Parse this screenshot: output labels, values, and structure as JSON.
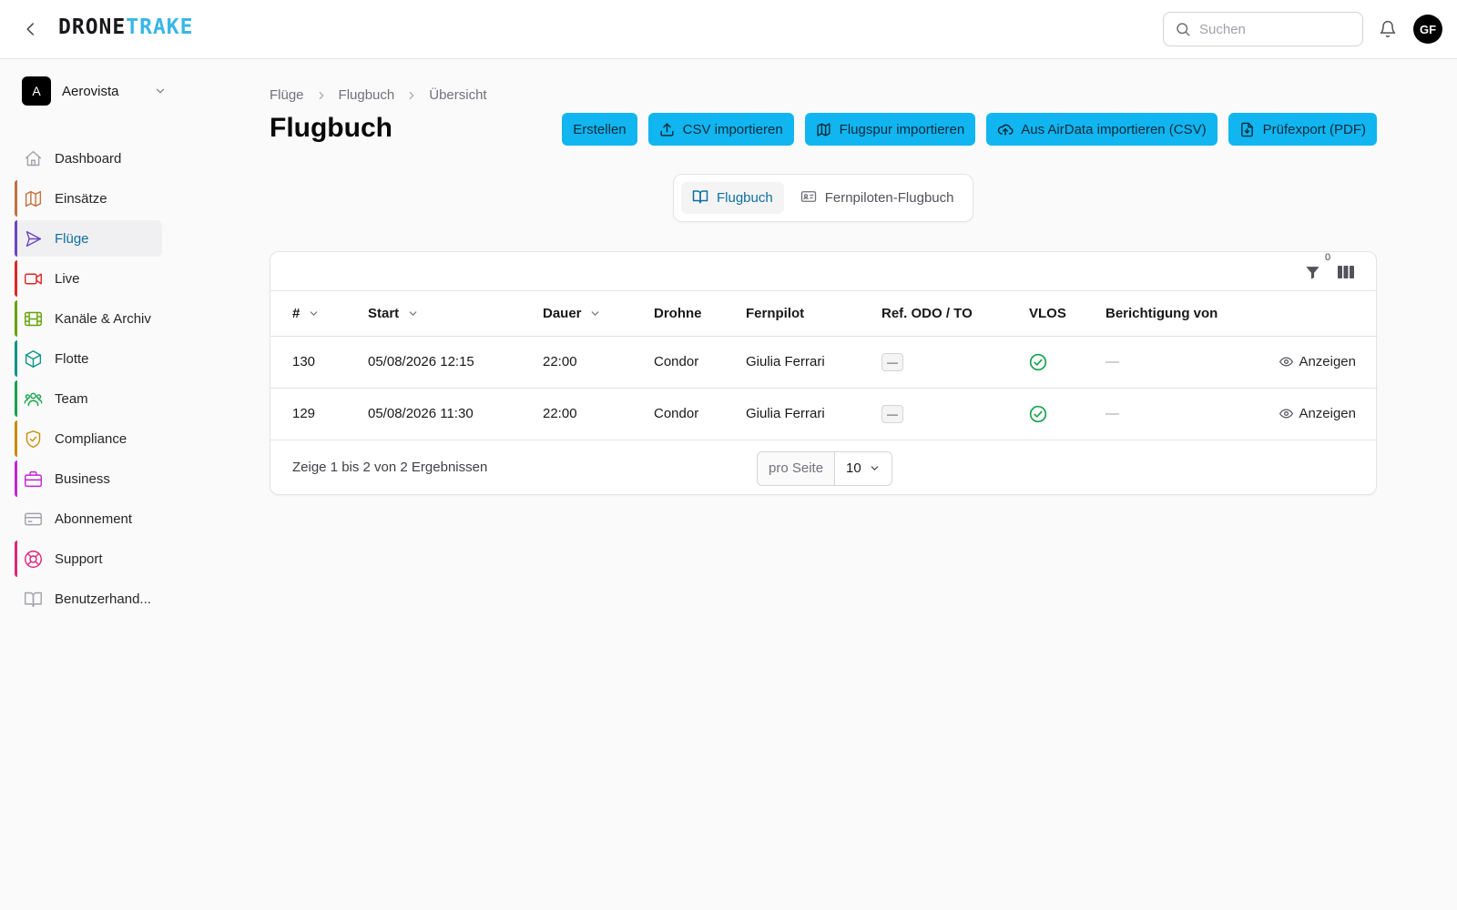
{
  "app": {
    "logo_part1": "DRONE",
    "logo_part2": "TRAKE",
    "brand_color": "#38b6e8",
    "accent_color": "#11b5f0"
  },
  "header": {
    "search_placeholder": "Suchen",
    "avatar_initials": "GF"
  },
  "org": {
    "badge": "A",
    "name": "Aerovista"
  },
  "sidebar": {
    "items": [
      {
        "label": "Dashboard",
        "icon": "home-icon",
        "color": "#a1a1aa",
        "active": false
      },
      {
        "label": "Einsätze",
        "icon": "map-icon",
        "color": "#c2703d",
        "active": false
      },
      {
        "label": "Flüge",
        "icon": "send-icon",
        "color": "#6b46c1",
        "active": true
      },
      {
        "label": "Live",
        "icon": "video-icon",
        "color": "#dc2626",
        "active": false
      },
      {
        "label": "Kanäle & Archiv",
        "icon": "film-icon",
        "color": "#65a30d",
        "active": false
      },
      {
        "label": "Flotte",
        "icon": "box-icon",
        "color": "#0d9488",
        "active": false
      },
      {
        "label": "Team",
        "icon": "users-icon",
        "color": "#16a34a",
        "active": false
      },
      {
        "label": "Compliance",
        "icon": "shield-check-icon",
        "color": "#ca8a04",
        "active": false
      },
      {
        "label": "Business",
        "icon": "briefcase-icon",
        "color": "#c026d3",
        "active": false
      },
      {
        "label": "Abonnement",
        "icon": "credit-card-icon",
        "color": "#a1a1aa",
        "active": false
      },
      {
        "label": "Support",
        "icon": "lifebuoy-icon",
        "color": "#db2777",
        "active": false
      },
      {
        "label": "Benutzerhand...",
        "icon": "book-icon",
        "color": "#a1a1aa",
        "active": false
      }
    ]
  },
  "breadcrumb": {
    "items": [
      "Flüge",
      "Flugbuch",
      "Übersicht"
    ]
  },
  "page": {
    "title": "Flugbuch"
  },
  "actions": [
    {
      "label": "Erstellen",
      "icon": ""
    },
    {
      "label": "CSV importieren",
      "icon": "upload-icon"
    },
    {
      "label": "Flugspur importieren",
      "icon": "map-icon"
    },
    {
      "label": "Aus AirData importieren (CSV)",
      "icon": "cloud-upload-icon"
    },
    {
      "label": "Prüfexport (PDF)",
      "icon": "file-download-icon"
    }
  ],
  "tabs": [
    {
      "label": "Flugbuch",
      "icon": "book-open-icon",
      "active": true
    },
    {
      "label": "Fernpiloten-Flugbuch",
      "icon": "id-card-icon",
      "active": false
    }
  ],
  "table": {
    "filter_count": "0",
    "columns": [
      "#",
      "Start",
      "Dauer",
      "Drohne",
      "Fernpilot",
      "Ref. ODO / TO",
      "VLOS",
      "Berichtigung von"
    ],
    "rows": [
      {
        "id": "130",
        "start": "05/08/2026 12:15",
        "dauer": "22:00",
        "drohne": "Condor",
        "fernpilot": "Giulia Ferrari",
        "ref": "—",
        "vlos": true,
        "berichtigung": "—",
        "action": "Anzeigen"
      },
      {
        "id": "129",
        "start": "05/08/2026 11:30",
        "dauer": "22:00",
        "drohne": "Condor",
        "fernpilot": "Giulia Ferrari",
        "ref": "—",
        "vlos": true,
        "berichtigung": "—",
        "action": "Anzeigen"
      }
    ]
  },
  "pagination": {
    "result_text": "Zeige 1 bis 2 von 2 Ergebnissen",
    "per_page_label": "pro Seite",
    "per_page_value": "10"
  }
}
